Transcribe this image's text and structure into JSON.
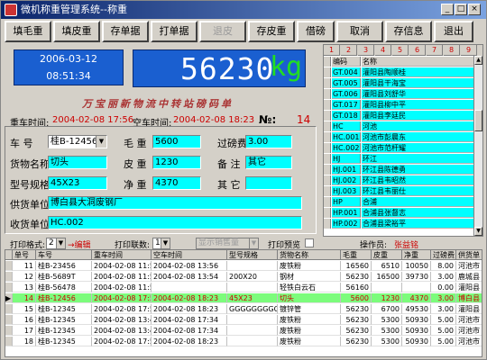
{
  "window": {
    "title": "微机称重管理系统--称重"
  },
  "titlebar_buttons": [
    "_",
    "□",
    "×"
  ],
  "toolbar": {
    "buttons": [
      "填毛重",
      "填皮重",
      "存单据",
      "打单据",
      "退皮",
      "存皮重",
      "借磅",
      "取消",
      "存信息",
      "退出"
    ]
  },
  "datetime": {
    "date": "2006-03-12",
    "time": "08:51:34"
  },
  "weight": {
    "value": "56230",
    "unit": "kg"
  },
  "scale_title": "万宝丽新物流中转站磅码单",
  "times": {
    "gross_label": "重车时间:",
    "gross_value": "2004-02-08 17:56",
    "tare_label": "空车时间:",
    "tare_value": "2004-02-08 18:23",
    "no_label": "№:",
    "no_value": "14"
  },
  "form": {
    "plate_label": "车    号",
    "plate_value": "桂B-12456",
    "gross_label": "毛  重",
    "gross_value": "5600",
    "fee_label": "过磅费",
    "fee_value": "3.00",
    "cargo_label": "货物名称",
    "cargo_value": "切头",
    "tare_label": "皮  重",
    "tare_value": "1230",
    "remark_label": "备  注",
    "remark_value": "其它",
    "spec_label": "型号规格",
    "spec_value": "45X23",
    "net_label": "净  重",
    "net_value": "4370",
    "other_label": "其  它",
    "other_value": "",
    "supplier_label": "供货单位",
    "supplier_value": "博白县大洞废钢厂",
    "receiver_label": "收货单位",
    "receiver_value": "HC.002"
  },
  "print_row": {
    "format_label": "打印格式:",
    "format_value": "2",
    "edit_link": "→编辑",
    "copies_label": "打印联数:",
    "copies_value": "1",
    "printer_value": "显示销售量",
    "preview_label": "打印预览",
    "operator_label": "操作员:",
    "operator_value": "张益铭"
  },
  "right_grid": {
    "col_numbers": [
      "1",
      "2",
      "3",
      "4",
      "5",
      "6",
      "7",
      "8",
      "9"
    ],
    "headers": [
      "编码",
      "名称"
    ],
    "rows": [
      [
        "GT.004",
        "灌阳县陶顺桂"
      ],
      [
        "GT.005",
        "灌阳县干海宝"
      ],
      [
        "GT.006",
        "灌阳县刘舒华"
      ],
      [
        "GT.017",
        "灌阳县柳中平"
      ],
      [
        "GT.018",
        "灌阳县李廷民"
      ],
      [
        "HC",
        "河池"
      ],
      [
        "HC.001",
        "河池市彭晨东"
      ],
      [
        "HC.002",
        "河池市范杆耀"
      ],
      [
        "HJ",
        "环江"
      ],
      [
        "HJ.001",
        "环江县陈德勇"
      ],
      [
        "HJ.002",
        "环江县韦昭然"
      ],
      [
        "HJ.003",
        "环江县韦丽仕"
      ],
      [
        "HP",
        "合浦"
      ],
      [
        "HP.001",
        "合浦县张督志"
      ],
      [
        "HP.002",
        "合浦县梁裕平"
      ]
    ]
  },
  "bottom_table": {
    "headers": [
      "单号",
      "车号",
      "重车时间",
      "空车时间",
      "型号规格",
      "货物名称",
      "毛重",
      "皮重",
      "净重",
      "过磅费",
      "供货单"
    ],
    "rows": [
      [
        "11",
        "桂B-23456",
        "2004-02-08 11:55",
        "2004-02-08 13:56",
        "",
        "废铁粉",
        "16560",
        "6510",
        "10050",
        "8.00",
        "河池市"
      ],
      [
        "12",
        "桂B-5689T",
        "2004-02-08 11:56",
        "2004-02-08 13:54",
        "200X20",
        "钢材",
        "56230",
        "16500",
        "39730",
        "3.00",
        "鹿城县"
      ],
      [
        "13",
        "桂B-56478",
        "2004-02-08 11:54",
        "",
        "",
        "轻铁白云石",
        "56160",
        "",
        "",
        "0.00",
        "灌阳县"
      ],
      [
        "14",
        "桂B-12456",
        "2004-02-08 17:56",
        "2004-02-08 18:23",
        "45X23",
        "切头",
        "5600",
        "1230",
        "4370",
        "3.00",
        "博白县"
      ],
      [
        "15",
        "桂B-12345",
        "2004-02-08 17:56",
        "2004-02-08 18:23",
        "GGGGGGGGG",
        "镀锌管",
        "56230",
        "6700",
        "49530",
        "3.00",
        "灌阳县"
      ],
      [
        "16",
        "桂B-12345",
        "2004-02-08 13:45",
        "2004-02-08 17:34",
        "",
        "废铁粉",
        "56230",
        "5300",
        "50930",
        "5.00",
        "河池市"
      ],
      [
        "17",
        "桂B-12345",
        "2004-02-08 13:45",
        "2004-02-08 17:34",
        "",
        "废铁粉",
        "56230",
        "5300",
        "50930",
        "5.00",
        "河池市"
      ],
      [
        "18",
        "桂B-12345",
        "2004-02-08 17:56",
        "2004-02-08 18:23",
        "",
        "废铁粉",
        "56230",
        "5300",
        "50930",
        "5.00",
        "河池市"
      ]
    ]
  }
}
